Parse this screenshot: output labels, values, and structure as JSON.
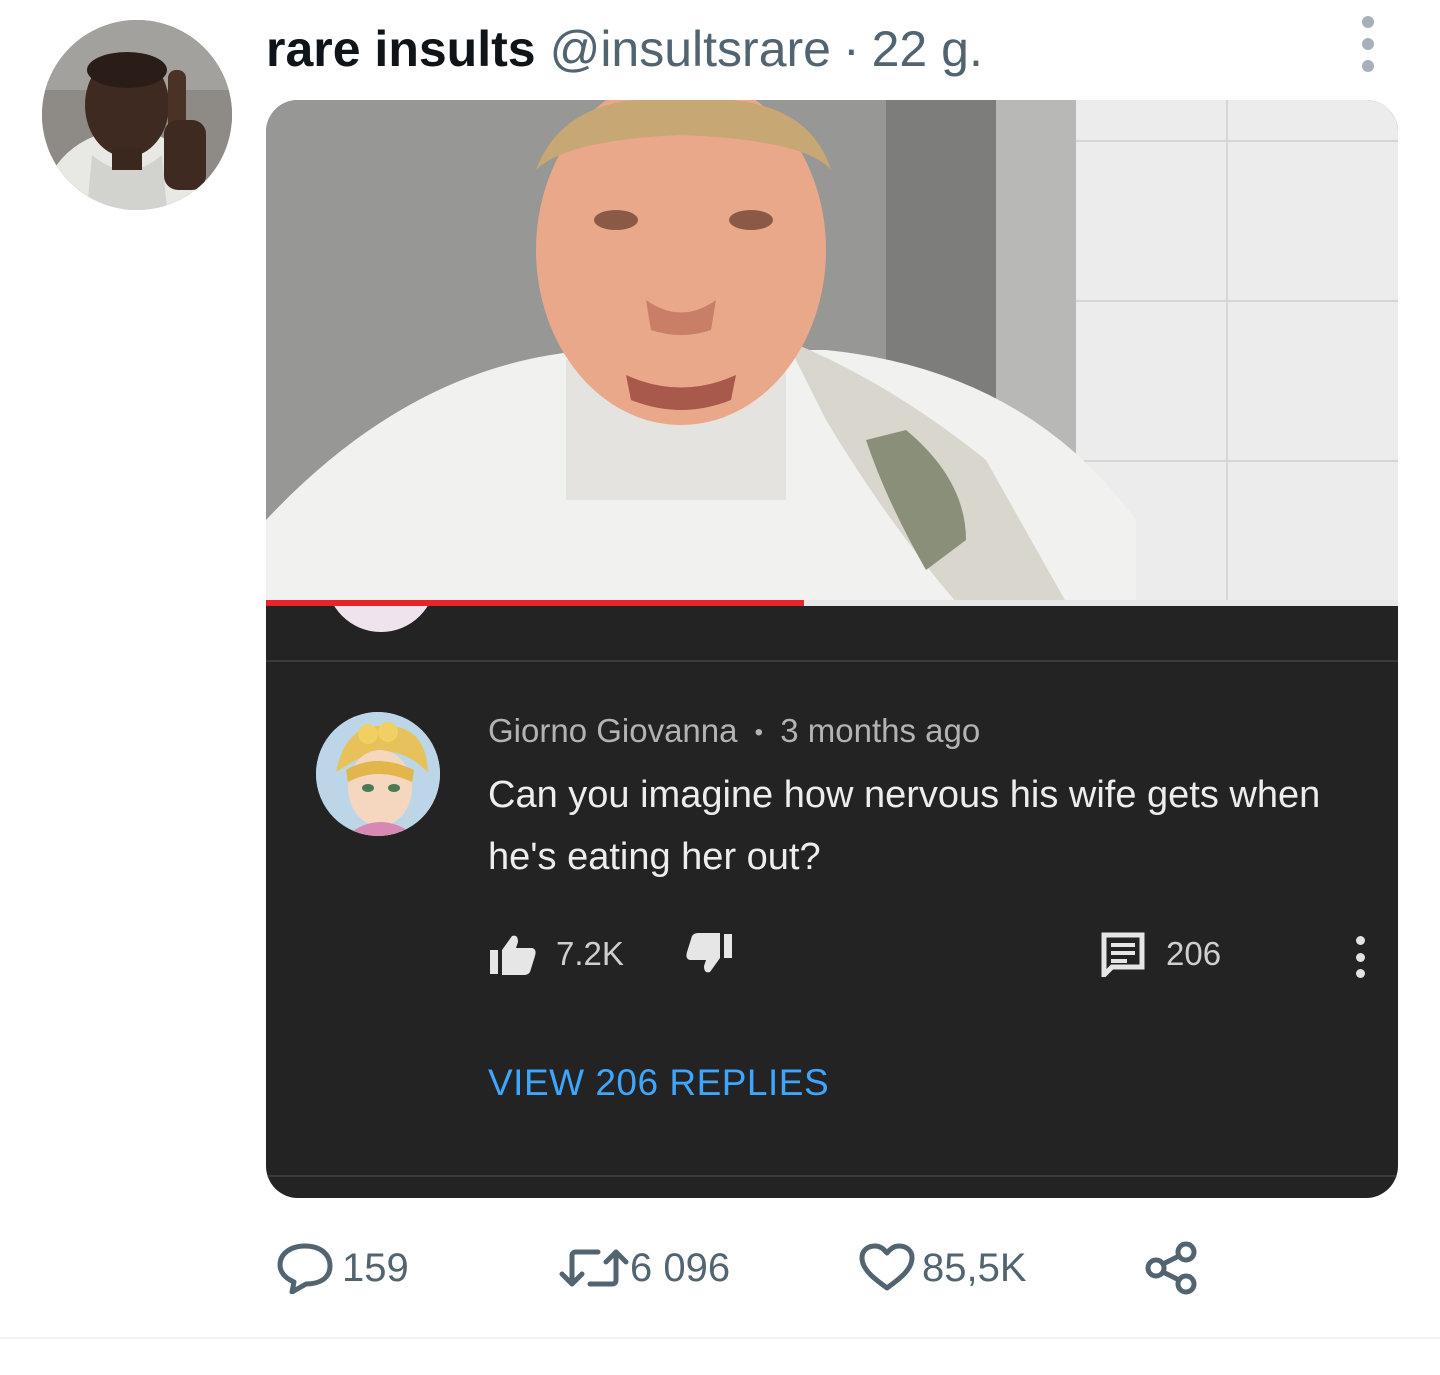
{
  "tweet": {
    "author_name": "rare insults",
    "handle": "@insultsrare",
    "separator": "·",
    "timestamp": "22 g."
  },
  "embedded_comment": {
    "progress_fraction": 0.475,
    "author": "Giorno Giovanna",
    "meta_separator": "•",
    "posted": "3 months ago",
    "text": "Can you imagine how nervous his wife gets when he's eating her out?",
    "likes": "7.2K",
    "replies_count": "206",
    "view_replies_label": "VIEW 206 REPLIES",
    "link_color": "#3ea6ff"
  },
  "actions": {
    "reply_count": "159",
    "retweet_count": "6 096",
    "like_count": "85,5K"
  },
  "icons": {
    "reply": "speech-bubble-icon",
    "retweet": "retweet-arrows-icon",
    "like": "heart-icon",
    "share": "share-nodes-icon",
    "more": "vertical-ellipsis-icon",
    "thumbs_up": "thumbs-up-icon",
    "thumbs_down": "thumbs-down-icon",
    "comment": "comment-icon"
  },
  "colors": {
    "text_primary": "#0f1419",
    "text_secondary": "#536471",
    "progress_red": "#e6242a"
  }
}
